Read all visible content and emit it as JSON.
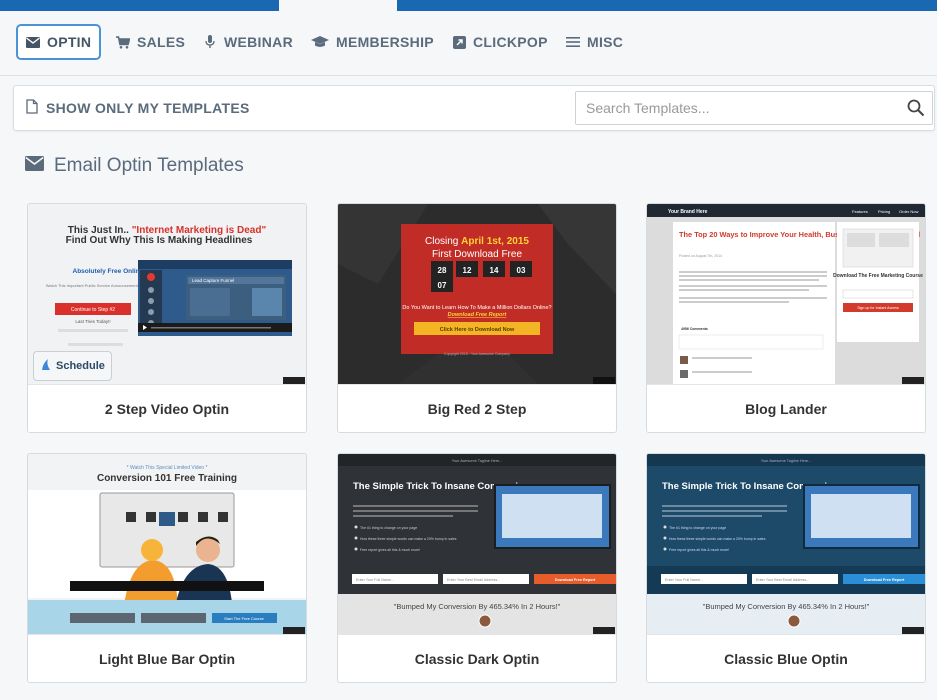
{
  "tabs": [
    {
      "label": "OPTIN",
      "icon": "envelope-icon",
      "active": true
    },
    {
      "label": "SALES",
      "icon": "cart-icon"
    },
    {
      "label": "WEBINAR",
      "icon": "microphone-icon"
    },
    {
      "label": "MEMBERSHIP",
      "icon": "graduation-cap-icon"
    },
    {
      "label": "CLICKPOP",
      "icon": "external-link-icon"
    },
    {
      "label": "MISC",
      "icon": "menu-icon"
    }
  ],
  "filter": {
    "show_only_label": "SHOW ONLY MY TEMPLATES",
    "search_placeholder": "Search Templates..."
  },
  "section": {
    "title": "Email Optin Templates"
  },
  "templates": [
    {
      "name": "2 Step Video Optin",
      "schedule_label": "Schedule",
      "preview": {
        "headline1": "This Just In.. ",
        "headline_highlight": "\"Internet Marketing is Dead\"",
        "headline2": "Find Out Why This Is Making Headlines",
        "side_title": "Absolutely Free Online Course",
        "side_sub": "Watch This Important Public Service Announcement.. Then Click Button to Continue",
        "side_button": "Continue to Step #2",
        "side_link": "Last Tries Today!!",
        "player_title": "Lead Capture Funnel"
      }
    },
    {
      "name": "Big Red 2 Step",
      "preview": {
        "line1": "Closing ",
        "line1_date": "April 1st, 2015",
        "line2": "First Download Free",
        "countdown": [
          "28",
          "12",
          "14",
          "03",
          "07"
        ],
        "question": "Do You Want to Learn How To Make a Million Dollars Online?",
        "question_link": "Download Free Report",
        "button": "Click Here to Download Now",
        "footer": "Copyright 2015 - Your Awesome Company"
      }
    },
    {
      "name": "Blog Lander",
      "preview": {
        "brand": "Your Brand Here",
        "nav": [
          "Features",
          "Pricing",
          "Order Now"
        ],
        "title": "The Top 20 Ways to Improve Your Health, Business and Get Focused",
        "date": "Posted on August 7th, 2014",
        "side_title": "Download The Free Marketing Course",
        "side_button": "Sign up for Instant Access",
        "comments": "4956 Comments"
      }
    },
    {
      "name": "Light Blue Bar Optin",
      "preview": {
        "kicker": "* Watch This Special Limited Video *",
        "title": "Conversion 101 Free Training",
        "bar_button": "Start The Free Course"
      }
    },
    {
      "name": "Classic Dark Optin",
      "preview": {
        "tagline": "Your Awesome Tagline Here...",
        "title": "The Simple Trick To Insane Conversions",
        "bullets": [
          "The #1 thing to change on your page",
          "How these three simple words can make a 20% bump in sales",
          "Free report gives all this & much more!"
        ],
        "name_ph": "Enter Your Full Name...",
        "email_ph": "Enter Your Best Email Address...",
        "button": "Download Free Report",
        "quote": "\"Bumped My Conversion By 465.34% In 2 Hours!\""
      }
    },
    {
      "name": "Classic Blue Optin",
      "preview": {
        "tagline": "Your Awesome Tagline Here...",
        "title": "The Simple Trick To Insane Conversions",
        "bullets": [
          "The #1 thing to change on your page",
          "How these three simple words can make a 20% bump in sales",
          "Free report gives all this & much more!"
        ],
        "name_ph": "Enter Your Full Name...",
        "email_ph": "Enter Your Best Email Address...",
        "button": "Download Free Report",
        "quote": "\"Bumped My Conversion By 465.34% In 2 Hours!\""
      }
    }
  ],
  "colors": {
    "topbar": "#1a67b2",
    "accent": "#4a93d6",
    "text_muted": "#5b6b7c"
  }
}
